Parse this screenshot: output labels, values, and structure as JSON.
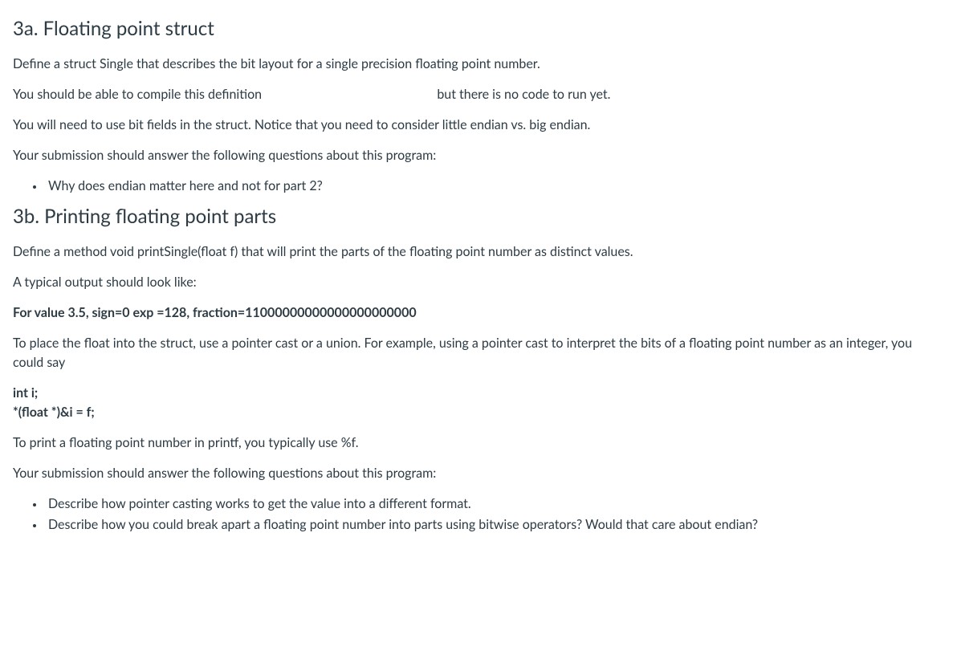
{
  "section_a": {
    "heading": "3a. Floating point struct",
    "p1": "Define a struct Single that describes the bit layout for a single precision floating point number.",
    "p2_part1": "You should be able to compile this definition",
    "p2_part2": "but there is no code to run yet.",
    "p3": "You will need to use bit fields in the struct. Notice that you need to consider little endian vs. big endian.",
    "p4": "Your submission should answer the following questions about this program:",
    "bullets": {
      "0": "Why does endian matter here and not for part 2?"
    }
  },
  "section_b": {
    "heading": "3b. Printing floating point parts",
    "p1": "Define a method void printSingle(float f) that will print the parts of the floating point number as distinct values.",
    "p2": "A typical output should look like:",
    "output": "For value 3.5, sign=0 exp =128, fraction=11000000000000000000000",
    "p3": "To place the float into the struct, use a pointer cast or a union. For example, using a pointer cast to interpret the bits of a floating point number as an integer, you could say",
    "code": {
      "line1": "int i;",
      "line2": "*(float *)&i = f;"
    },
    "p4": "To print a floating point number in printf, you typically use %f.",
    "p5": "Your submission should answer the following questions about this program:",
    "bullets": {
      "0": "Describe how pointer casting works to get the value into a different format.",
      "1": "Describe how you could break apart a floating point number into parts using bitwise operators? Would that care about endian?"
    }
  }
}
